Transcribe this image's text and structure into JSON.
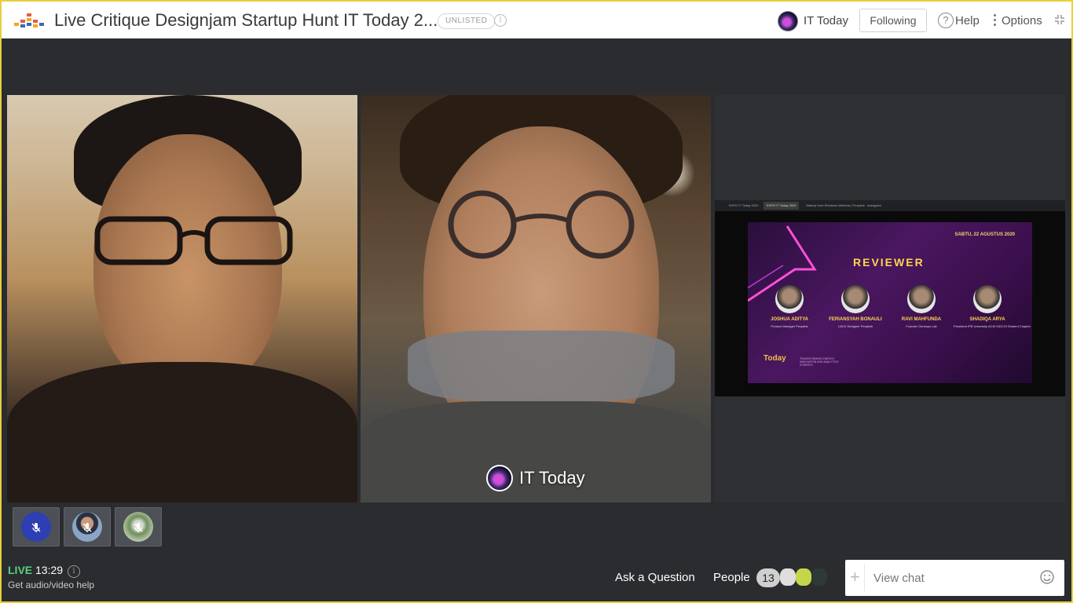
{
  "header": {
    "title": "Live Critique Designjam Startup Hunt IT Today 2...",
    "badge": "UNLISTED",
    "channel_name": "IT Today",
    "follow_label": "Following",
    "help_label": "Help",
    "options_label": "Options"
  },
  "stage": {
    "presenter_name": "IT Today",
    "shared_screen": {
      "tabs": [
        "EXPO IT Today 2020",
        "EXPO IT Today 2020",
        "Startup Hunt Reviewer Webinar | Peoplink",
        "Instagram"
      ],
      "slide": {
        "date": "SABTU, 22 AGUSTUS 2020",
        "title": "REVIEWER",
        "reviewers": [
          {
            "name": "JOSHUA ADITYA",
            "role": "Product Manager Peoplink"
          },
          {
            "name": "FERIANSYAH BONAULI",
            "role": "UI/UX Designer Peoplink"
          },
          {
            "name": "RAVI MAHFUNDA",
            "role": "Founder Genesys Lab"
          },
          {
            "name": "SHADIQA ARYA",
            "role": "President IPB University ACM SIGCHI Student Chapter"
          }
        ],
        "logo_text": "Today",
        "tagline": "TRANSFORMING ENERGY, INNOVATION AND ANALYTICS SYNERGY"
      }
    }
  },
  "bottom": {
    "live_label": "LIVE",
    "time": "13:29",
    "help_link": "Get audio/video help",
    "ask_label": "Ask a Question",
    "people_label": "People",
    "people_count": "13",
    "chat_placeholder": "View chat"
  },
  "colors": {
    "frame_border": "#e8cf3a",
    "live_green": "#5ad17f",
    "stage_bg": "#2a2c2f",
    "slide_accent": "#ffd64d"
  },
  "icons": [
    "logo-icon",
    "info-icon",
    "help-icon",
    "options-icon",
    "collapse-icon",
    "mic-muted-icon",
    "plus-icon",
    "emoji-icon"
  ]
}
